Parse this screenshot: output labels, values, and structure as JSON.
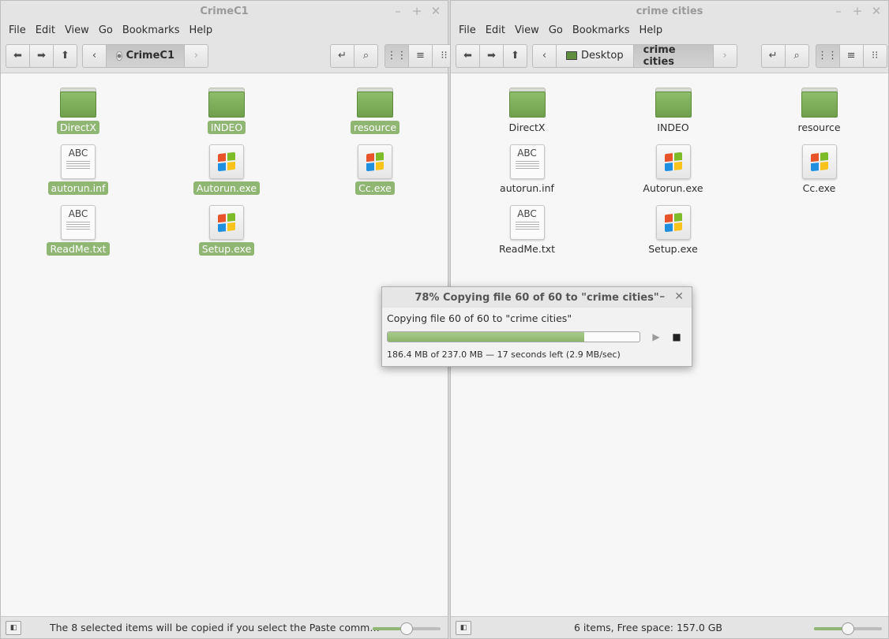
{
  "left": {
    "title": "CrimeC1",
    "menu": [
      "File",
      "Edit",
      "View",
      "Go",
      "Bookmarks",
      "Help"
    ],
    "path": [
      {
        "label": "CrimeC1",
        "icon": "disc-icon"
      }
    ],
    "items": [
      {
        "name": "DirectX",
        "kind": "folder"
      },
      {
        "name": "INDEO",
        "kind": "folder"
      },
      {
        "name": "resource",
        "kind": "folder"
      },
      {
        "name": "autorun.inf",
        "kind": "text"
      },
      {
        "name": "Autorun.exe",
        "kind": "exe"
      },
      {
        "name": "Cc.exe",
        "kind": "exe"
      },
      {
        "name": "ReadMe.txt",
        "kind": "text"
      },
      {
        "name": "Setup.exe",
        "kind": "exe"
      }
    ],
    "status": "The 8 selected items will be copied if you select the Paste comm…",
    "zoom_level": 0.5
  },
  "right": {
    "title": "crime cities",
    "menu": [
      "File",
      "Edit",
      "View",
      "Go",
      "Bookmarks",
      "Help"
    ],
    "path": [
      {
        "label": "Desktop",
        "icon": "desktop-icon"
      },
      {
        "label": "crime cities",
        "icon": ""
      }
    ],
    "items": [
      {
        "name": "DirectX",
        "kind": "folder"
      },
      {
        "name": "INDEO",
        "kind": "folder"
      },
      {
        "name": "resource",
        "kind": "folder"
      },
      {
        "name": "autorun.inf",
        "kind": "text"
      },
      {
        "name": "Autorun.exe",
        "kind": "exe"
      },
      {
        "name": "Cc.exe",
        "kind": "exe"
      },
      {
        "name": "ReadMe.txt",
        "kind": "text"
      },
      {
        "name": "Setup.exe",
        "kind": "exe"
      }
    ],
    "status": "6 items, Free space: 157.0 GB",
    "zoom_level": 0.5
  },
  "dialog": {
    "title": "78% Copying file 60 of 60 to \"crime cities\"",
    "message": "Copying file 60 of 60 to \"crime cities\"",
    "progress": 0.78,
    "detail": "186.4 MB of 237.0 MB — 17 seconds left (2.9 MB/sec)"
  },
  "icons": {
    "abc": "ABC"
  },
  "colors": {
    "selection": "#8fb672",
    "folder": "#7aab55"
  }
}
